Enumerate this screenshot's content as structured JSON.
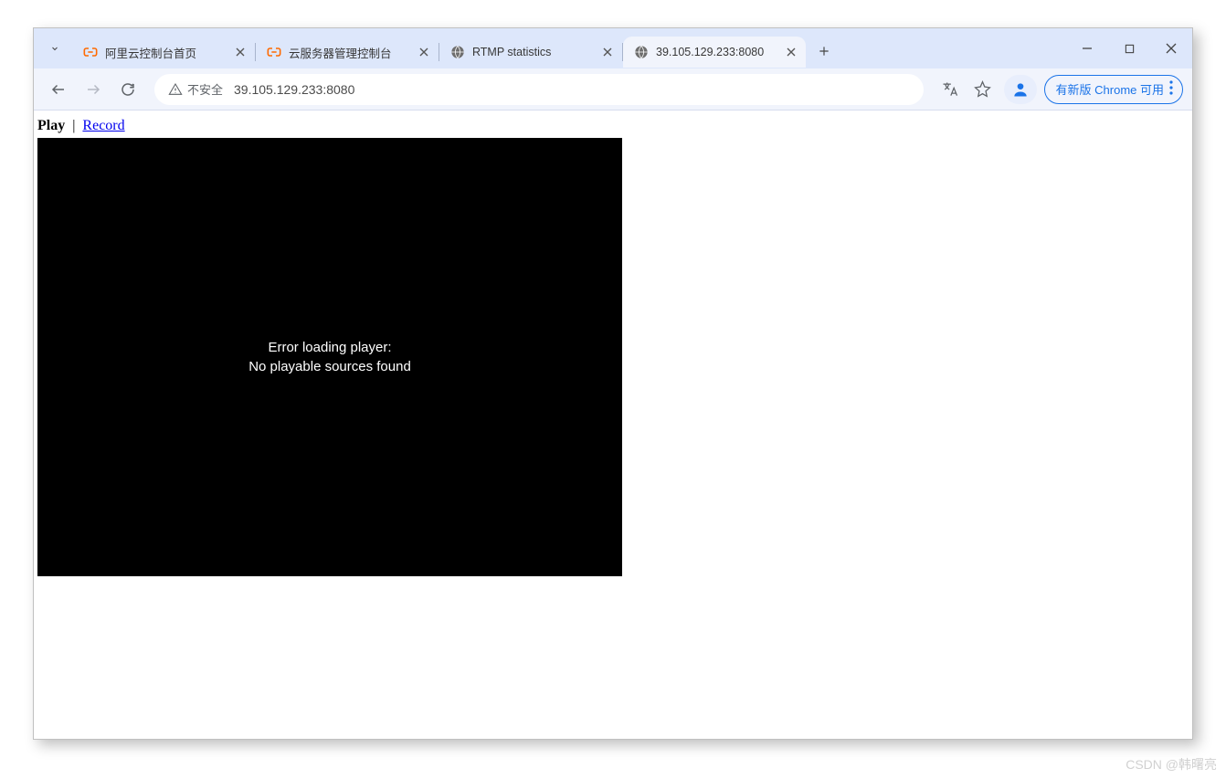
{
  "window": {
    "update_label": "有新版 Chrome 可用"
  },
  "tabs": [
    {
      "title": "阿里云控制台首页",
      "icon": "aliyun"
    },
    {
      "title": "云服务器管理控制台",
      "icon": "aliyun"
    },
    {
      "title": "RTMP statistics",
      "icon": "globe"
    },
    {
      "title": "39.105.129.233:8080",
      "icon": "globe",
      "active": true
    }
  ],
  "addressbar": {
    "security_label": "不安全",
    "url": "39.105.129.233:8080"
  },
  "page": {
    "nav": {
      "play": "Play",
      "record": "Record"
    },
    "player_error_line1": "Error loading player:",
    "player_error_line2": "No playable sources found"
  },
  "watermark": "CSDN @韩曙亮"
}
